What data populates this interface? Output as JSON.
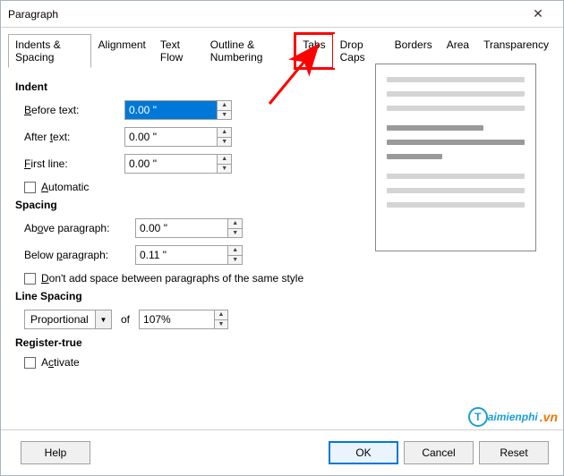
{
  "title": "Paragraph",
  "tabs": {
    "t0": "Indents & Spacing",
    "t1": "Alignment",
    "t2": "Text Flow",
    "t3": "Outline & Numbering",
    "t4": "Tabs",
    "t5": "Drop Caps",
    "t6": "Borders",
    "t7": "Area",
    "t8": "Transparency"
  },
  "sections": {
    "indent": "Indent",
    "spacing": "Spacing",
    "linespacing": "Line Spacing",
    "registertrue": "Register-true"
  },
  "labels": {
    "before_text": "Before text:",
    "after_text": "After text:",
    "first_line": "First line:",
    "automatic": "Automatic",
    "above_para": "Above paragraph:",
    "below_para": "Below paragraph:",
    "no_space_same": "Don't add space between paragraphs of the same style",
    "of": "of",
    "activate": "Activate"
  },
  "values": {
    "before_text": "0.00 \"",
    "after_text": "0.00 \"",
    "first_line": "0.00 \"",
    "above_para": "0.00 \"",
    "below_para": "0.11 \"",
    "linespacing_mode": "Proportional",
    "linespacing_value": "107%"
  },
  "buttons": {
    "help": "Help",
    "ok": "OK",
    "cancel": "Cancel",
    "reset": "Reset"
  },
  "watermark": {
    "prefix": "T",
    "text": "aimienphi",
    "suffix": ".vn"
  }
}
